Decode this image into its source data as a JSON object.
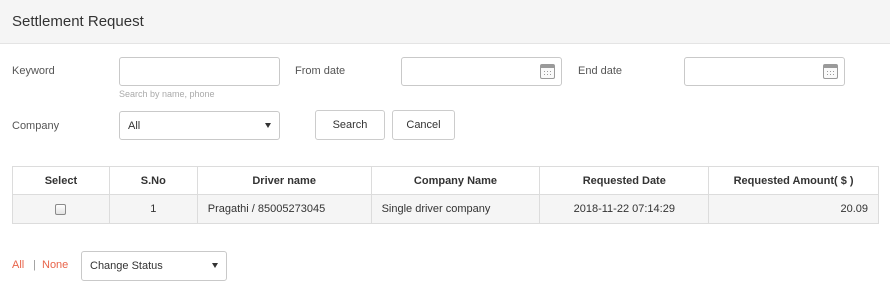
{
  "page": {
    "title": "Settlement Request"
  },
  "filters": {
    "keyword_label": "Keyword",
    "keyword_value": "",
    "keyword_placeholder": "",
    "keyword_hint": "Search by name, phone",
    "from_date_label": "From date",
    "from_date_value": "",
    "end_date_label": "End date",
    "end_date_value": "",
    "company_label": "Company",
    "company_selected": "All",
    "search_label": "Search",
    "cancel_label": "Cancel"
  },
  "table": {
    "headers": [
      "Select",
      "S.No",
      "Driver name",
      "Company Name",
      "Requested Date",
      "Requested Amount( $ )"
    ],
    "rows": [
      {
        "sno": "1",
        "driver": "Pragathi / 85005273045",
        "company": "Single driver company",
        "date": "2018-11-22 07:14:29",
        "amount": "20.09"
      }
    ]
  },
  "bulk": {
    "all_label": "All",
    "separator": "|",
    "none_label": "None",
    "status_selected": "Change Status"
  },
  "colors": {
    "link": "#e8644a",
    "header_bg": "#f5f5f5"
  },
  "icons": {
    "calendar": "calendar-icon",
    "dropdown": "chevron-down-icon"
  }
}
